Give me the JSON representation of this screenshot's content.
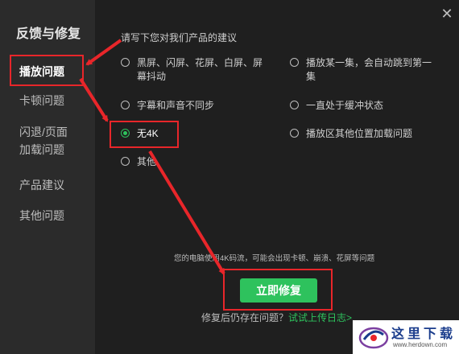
{
  "window": {
    "title": "反馈与修复",
    "close_label": "✕"
  },
  "sidebar": {
    "items": [
      {
        "label": "播放问题",
        "active": true
      },
      {
        "label": "卡顿问题"
      },
      {
        "label": "闪退/页面"
      },
      {
        "label": "加载问题"
      },
      {
        "label": "产品建议"
      },
      {
        "label": "其他问题"
      }
    ]
  },
  "main": {
    "prompt": "请写下您对我们产品的建议",
    "options": [
      {
        "label": "黑屏、闪屏、花屏、白屏、屏"
      },
      {
        "label": "幕抖动"
      },
      {
        "label": "播放某一集，会自动跳到第一"
      },
      {
        "label": "集"
      },
      {
        "label": "字幕和声音不同步"
      },
      {
        "label": "一直处于缓冲状态"
      },
      {
        "label": "无4K",
        "selected": true
      },
      {
        "label": "播放区其他位置加载问题"
      },
      {
        "label": "其他"
      }
    ],
    "warning": "您的电脑使用4K码流，可能会出现卡顿、崩溃、花屏等问题",
    "fix_button": "立即修复",
    "footer_text": "修复后仍存在问题？",
    "footer_link": "试试上传日志>"
  },
  "watermark": {
    "name": "这里下载",
    "url": "www.herdown.com"
  },
  "colors": {
    "accent": "#2ec25d",
    "annotation": "#e8262a",
    "sidebar_bg": "#2b2b2b",
    "main_bg": "#1f1f1f"
  }
}
